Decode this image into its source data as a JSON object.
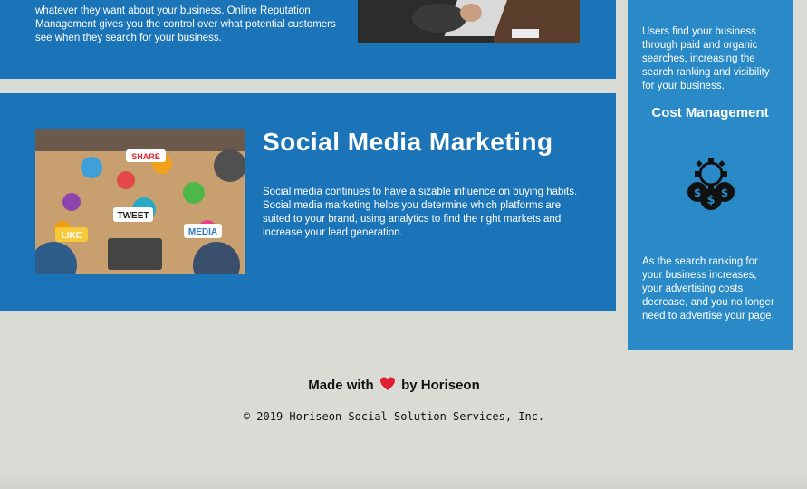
{
  "orm": {
    "text": "whatever they want about your business. Online Reputation Management gives you the control over what potential customers see when they search for your business."
  },
  "smm": {
    "title": "Social Media Marketing",
    "text": "Social media continues to have a sizable influence on buying habits. Social media marketing helps you determine which platforms are suited to your brand, using analytics to find the right markets and increase your lead generation.",
    "image_labels": {
      "share": "SHARE",
      "tweet": "TWEET",
      "like": "LIKE",
      "media": "MEDIA"
    }
  },
  "sidebar": {
    "text_1": "Users find your business through paid and organic searches, increasing the search ranking and visibility for your business.",
    "heading": "Cost Management",
    "icon": "cost-management-icon",
    "text_2": "As the search ranking for your business increases, your advertising costs decrease, and you no longer need to advertise your page."
  },
  "footer": {
    "made_prefix": "Made with",
    "made_suffix": "by Horiseon",
    "copyright": "© 2019 Horiseon Social Solution Services, Inc."
  },
  "colors": {
    "card_blue": "#1b74b8",
    "sidebar_blue": "#2a8ac7",
    "background": "#d9dbd5",
    "heart": "#e0202e"
  }
}
